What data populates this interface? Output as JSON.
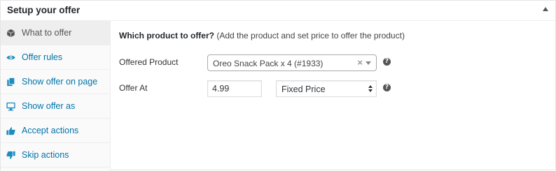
{
  "panel": {
    "title": "Setup your offer"
  },
  "sidebar": {
    "items": [
      {
        "label": "What to offer",
        "icon": "cube-icon",
        "active": true
      },
      {
        "label": "Offer rules",
        "icon": "eye-icon"
      },
      {
        "label": "Show offer on page",
        "icon": "page-copy-icon"
      },
      {
        "label": "Show offer as",
        "icon": "desktop-icon"
      },
      {
        "label": "Accept actions",
        "icon": "thumbs-up-icon"
      },
      {
        "label": "Skip actions",
        "icon": "thumbs-down-icon"
      }
    ]
  },
  "main": {
    "heading_bold": "Which product to offer?",
    "heading_note": "(Add the product and set price to offer the product)",
    "offered_product": {
      "label": "Offered Product",
      "value": "Oreo Snack Pack x 4 (#1933)",
      "clear_symbol": "×"
    },
    "offer_at": {
      "label": "Offer At",
      "price": "4.99",
      "price_type": "Fixed Price"
    },
    "help_symbol": "?"
  },
  "colors": {
    "link": "#0073aa",
    "icon": "#1e8cbe",
    "active_tab_bg": "#eeeeee",
    "active_text": "#555555"
  }
}
